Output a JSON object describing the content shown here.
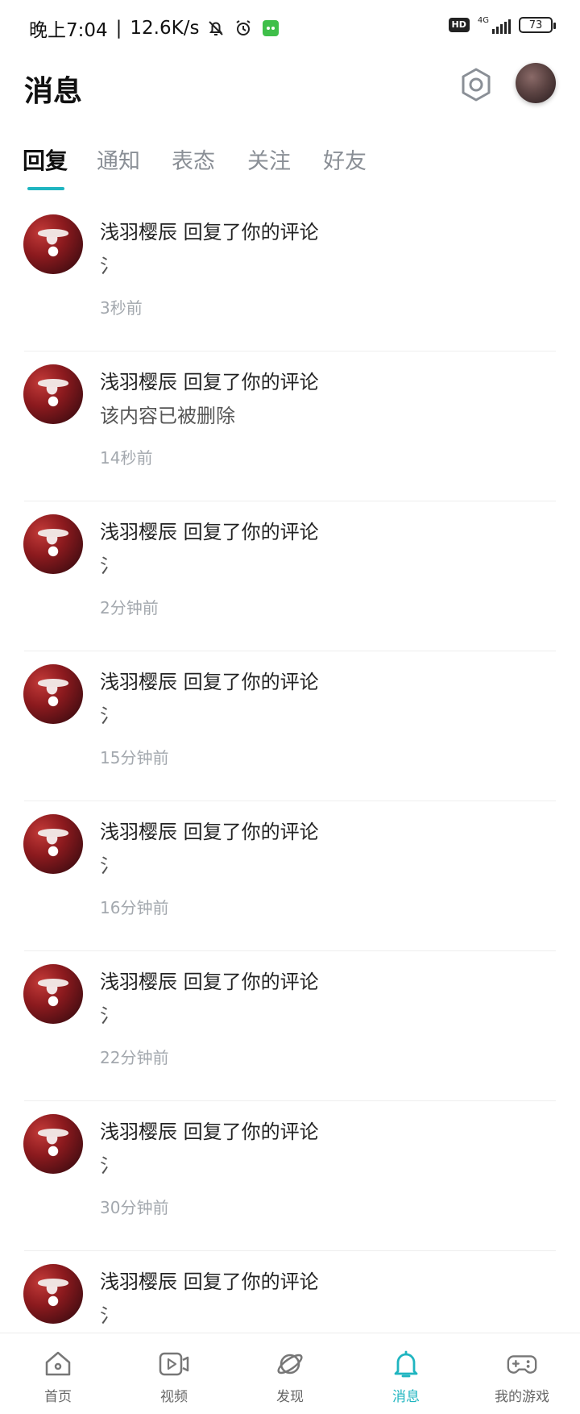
{
  "status_bar": {
    "time": "晚上7:04",
    "separator": "|",
    "speed": "12.6K/s",
    "icons": [
      "mute-bell-icon",
      "alarm-icon",
      "app-notification-icon"
    ],
    "hd_label": "HD",
    "network": "4G",
    "battery": "73"
  },
  "header": {
    "title": "消息",
    "settings_icon": "gear-icon",
    "avatar_icon": "user-avatar"
  },
  "tabs": [
    {
      "label": "回复",
      "active": true
    },
    {
      "label": "通知",
      "active": false
    },
    {
      "label": "表态",
      "active": false
    },
    {
      "label": "关注",
      "active": false
    },
    {
      "label": "好友",
      "active": false
    }
  ],
  "messages": [
    {
      "title": "浅羽樱辰 回复了你的评论",
      "body": "氵",
      "time": "3秒前"
    },
    {
      "title": "浅羽樱辰 回复了你的评论",
      "body": "该内容已被删除",
      "time": "14秒前"
    },
    {
      "title": "浅羽樱辰 回复了你的评论",
      "body": "氵",
      "time": "2分钟前"
    },
    {
      "title": "浅羽樱辰 回复了你的评论",
      "body": "氵",
      "time": "15分钟前"
    },
    {
      "title": "浅羽樱辰 回复了你的评论",
      "body": "氵",
      "time": "16分钟前"
    },
    {
      "title": "浅羽樱辰 回复了你的评论",
      "body": "氵",
      "time": "22分钟前"
    },
    {
      "title": "浅羽樱辰 回复了你的评论",
      "body": "氵",
      "time": "30分钟前"
    },
    {
      "title": "浅羽樱辰 回复了你的评论",
      "body": "氵",
      "time": ""
    }
  ],
  "bottom_nav": [
    {
      "label": "首页",
      "icon": "home-icon",
      "active": false
    },
    {
      "label": "视频",
      "icon": "video-icon",
      "active": false
    },
    {
      "label": "发现",
      "icon": "planet-icon",
      "active": false
    },
    {
      "label": "消息",
      "icon": "bell-icon",
      "active": true
    },
    {
      "label": "我的游戏",
      "icon": "gamepad-icon",
      "active": false
    }
  ],
  "colors": {
    "accent": "#1fb5c0",
    "text_primary": "#222222",
    "text_secondary": "#a3a8ae"
  }
}
